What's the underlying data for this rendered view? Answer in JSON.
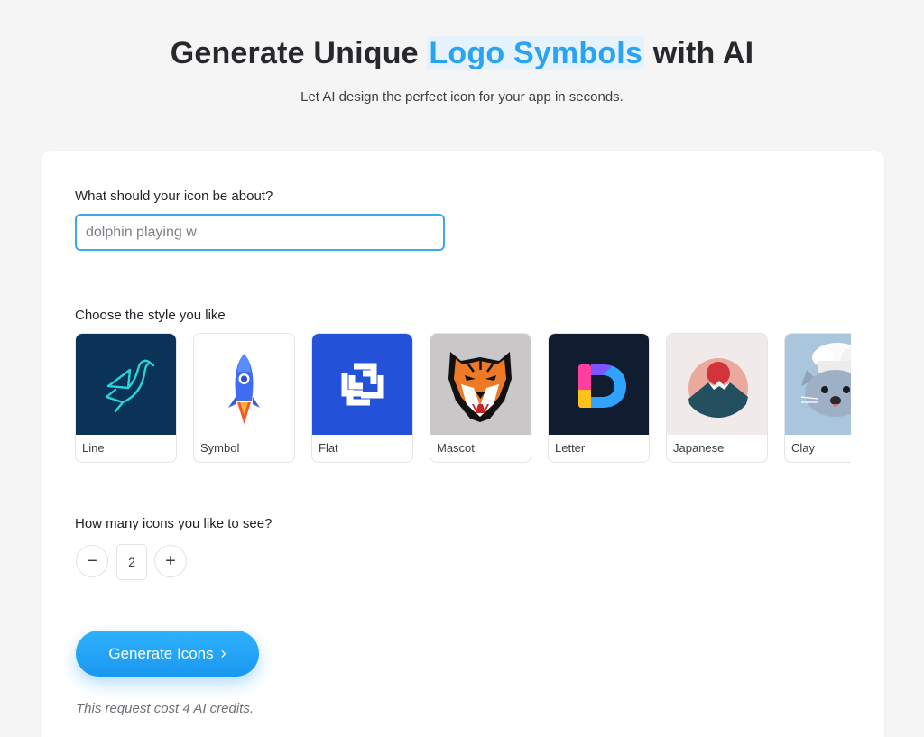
{
  "hero": {
    "title_prefix": "Generate Unique ",
    "title_highlight": "Logo Symbols",
    "title_suffix": " with AI",
    "subtitle": "Let AI design the perfect icon for your app in seconds."
  },
  "prompt": {
    "label": "What should your icon be about?",
    "value": "dolphin playing w"
  },
  "styles": {
    "label": "Choose the style you like",
    "items": [
      {
        "label": "Line",
        "icon": "line-bird-icon"
      },
      {
        "label": "Symbol",
        "icon": "rocket-icon"
      },
      {
        "label": "Flat",
        "icon": "flat-squares-icon"
      },
      {
        "label": "Mascot",
        "icon": "tiger-mascot-icon"
      },
      {
        "label": "Letter",
        "icon": "letter-d-icon"
      },
      {
        "label": "Japanese",
        "icon": "mountain-sun-icon"
      },
      {
        "label": "Clay",
        "icon": "clay-chef-cat-icon"
      }
    ]
  },
  "count": {
    "label": "How many icons you like to see?",
    "decrement_symbol": "−",
    "value": "2",
    "increment_symbol": "+"
  },
  "generate": {
    "label": "Generate Icons",
    "chevron": "›"
  },
  "credits_note": "This request cost 4 AI credits.",
  "colors": {
    "accent": "#2aa3f0",
    "button": "#1fa2f5",
    "background": "#f5f5f6"
  }
}
